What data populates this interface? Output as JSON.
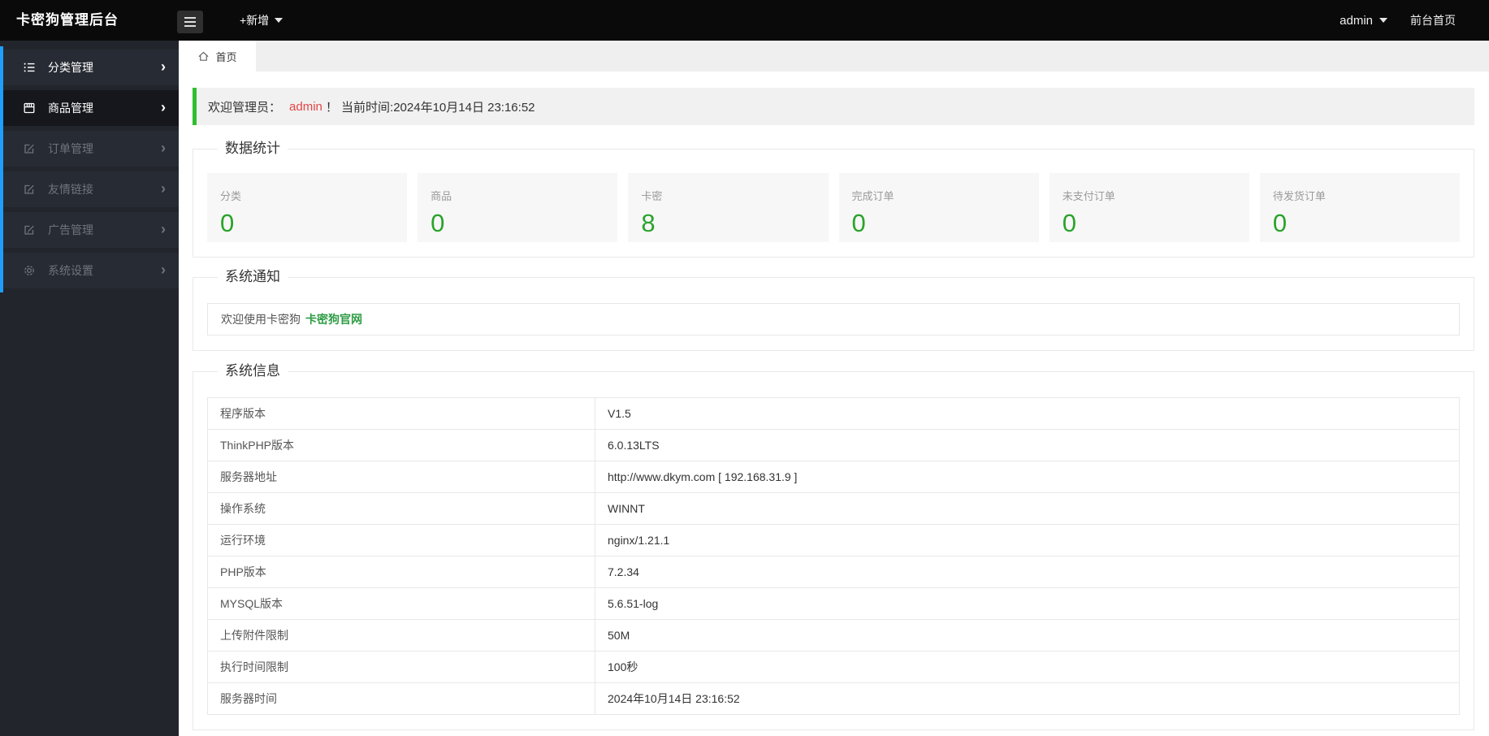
{
  "header": {
    "title": "卡密狗管理后台",
    "add_button": "+新增",
    "user": "admin",
    "front_link": "前台首页"
  },
  "sidebar": {
    "items": [
      {
        "label": "分类管理",
        "icon": "list-icon"
      },
      {
        "label": "商品管理",
        "icon": "shop-icon"
      },
      {
        "label": "订单管理",
        "icon": "form-icon"
      },
      {
        "label": "友情链接",
        "icon": "form-icon"
      },
      {
        "label": "广告管理",
        "icon": "form-icon"
      },
      {
        "label": "系统设置",
        "icon": "gear-icon"
      }
    ]
  },
  "tabs": {
    "home": "首页"
  },
  "welcome": {
    "prefix": "欢迎管理员：",
    "admin": "admin",
    "suffix": "！ 当前时间:2024年10月14日 23:16:52"
  },
  "stats": {
    "section_title": "数据统计",
    "cards": [
      {
        "label": "分类",
        "value": "0"
      },
      {
        "label": "商品",
        "value": "0"
      },
      {
        "label": "卡密",
        "value": "8"
      },
      {
        "label": "完成订单",
        "value": "0"
      },
      {
        "label": "未支付订单",
        "value": "0"
      },
      {
        "label": "待发货订单",
        "value": "0"
      }
    ]
  },
  "notice": {
    "section_title": "系统通知",
    "text": "欢迎使用卡密狗",
    "link": "卡密狗官网"
  },
  "sysinfo": {
    "section_title": "系统信息",
    "rows": [
      {
        "label": "程序版本",
        "value": "V1.5"
      },
      {
        "label": "ThinkPHP版本",
        "value": "6.0.13LTS"
      },
      {
        "label": "服务器地址",
        "value": "http://www.dkym.com [ 192.168.31.9 ]"
      },
      {
        "label": "操作系统",
        "value": "WINNT"
      },
      {
        "label": "运行环境",
        "value": "nginx/1.21.1"
      },
      {
        "label": "PHP版本",
        "value": "7.2.34"
      },
      {
        "label": "MYSQL版本",
        "value": "5.6.51-log"
      },
      {
        "label": "上传附件限制",
        "value": "50M"
      },
      {
        "label": "执行时间限制",
        "value": "100秒"
      },
      {
        "label": "服务器时间",
        "value": "2024年10月14日 23:16:52"
      }
    ]
  },
  "colors": {
    "green": "#2aa32a",
    "link-green": "#2e9c44",
    "alert-green": "#2ec02e",
    "red": "#e64545",
    "blue": "#1e9fff"
  }
}
